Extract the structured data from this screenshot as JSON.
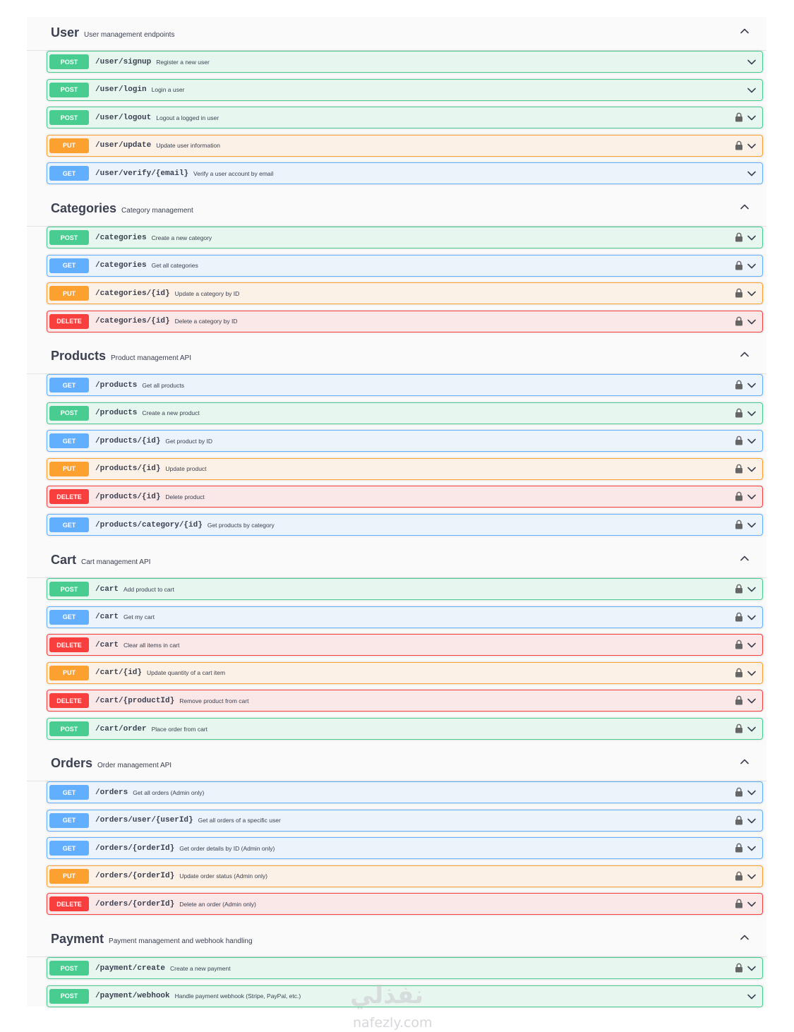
{
  "sections": [
    {
      "name": "User",
      "description": "User management endpoints",
      "operations": [
        {
          "method": "POST",
          "path": "/user/signup",
          "summary": "Register a new user",
          "locked": false
        },
        {
          "method": "POST",
          "path": "/user/login",
          "summary": "Login a user",
          "locked": false
        },
        {
          "method": "POST",
          "path": "/user/logout",
          "summary": "Logout a logged in user",
          "locked": true
        },
        {
          "method": "PUT",
          "path": "/user/update",
          "summary": "Update user information",
          "locked": true
        },
        {
          "method": "GET",
          "path": "/user/verify/{email}",
          "summary": "Verify a user account by email",
          "locked": false
        }
      ]
    },
    {
      "name": "Categories",
      "description": "Category management",
      "operations": [
        {
          "method": "POST",
          "path": "/categories",
          "summary": "Create a new category",
          "locked": true
        },
        {
          "method": "GET",
          "path": "/categories",
          "summary": "Get all categories",
          "locked": true
        },
        {
          "method": "PUT",
          "path": "/categories/{id}",
          "summary": "Update a category by ID",
          "locked": true
        },
        {
          "method": "DELETE",
          "path": "/categories/{id}",
          "summary": "Delete a category by ID",
          "locked": true
        }
      ]
    },
    {
      "name": "Products",
      "description": "Product management API",
      "operations": [
        {
          "method": "GET",
          "path": "/products",
          "summary": "Get all products",
          "locked": true
        },
        {
          "method": "POST",
          "path": "/products",
          "summary": "Create a new product",
          "locked": true
        },
        {
          "method": "GET",
          "path": "/products/{id}",
          "summary": "Get product by ID",
          "locked": true
        },
        {
          "method": "PUT",
          "path": "/products/{id}",
          "summary": "Update product",
          "locked": true
        },
        {
          "method": "DELETE",
          "path": "/products/{id}",
          "summary": "Delete product",
          "locked": true
        },
        {
          "method": "GET",
          "path": "/products/category/{id}",
          "summary": "Get products by category",
          "locked": true
        }
      ]
    },
    {
      "name": "Cart",
      "description": "Cart management API",
      "operations": [
        {
          "method": "POST",
          "path": "/cart",
          "summary": "Add product to cart",
          "locked": true
        },
        {
          "method": "GET",
          "path": "/cart",
          "summary": "Get my cart",
          "locked": true
        },
        {
          "method": "DELETE",
          "path": "/cart",
          "summary": "Clear all items in cart",
          "locked": true
        },
        {
          "method": "PUT",
          "path": "/cart/{id}",
          "summary": "Update quantity of a cart item",
          "locked": true
        },
        {
          "method": "DELETE",
          "path": "/cart/{productId}",
          "summary": "Remove product from cart",
          "locked": true
        },
        {
          "method": "POST",
          "path": "/cart/order",
          "summary": "Place order from cart",
          "locked": true
        }
      ]
    },
    {
      "name": "Orders",
      "description": "Order management API",
      "operations": [
        {
          "method": "GET",
          "path": "/orders",
          "summary": "Get all orders (Admin only)",
          "locked": true
        },
        {
          "method": "GET",
          "path": "/orders/user/{userId}",
          "summary": "Get all orders of a specific user",
          "locked": true
        },
        {
          "method": "GET",
          "path": "/orders/{orderId}",
          "summary": "Get order details by ID (Admin only)",
          "locked": true
        },
        {
          "method": "PUT",
          "path": "/orders/{orderId}",
          "summary": "Update order status (Admin only)",
          "locked": true
        },
        {
          "method": "DELETE",
          "path": "/orders/{orderId}",
          "summary": "Delete an order (Admin only)",
          "locked": true
        }
      ]
    },
    {
      "name": "Payment",
      "description": "Payment management and webhook handling",
      "operations": [
        {
          "method": "POST",
          "path": "/payment/create",
          "summary": "Create a new payment",
          "locked": true
        },
        {
          "method": "POST",
          "path": "/payment/webhook",
          "summary": "Handle payment webhook (Stripe, PayPal, etc.)",
          "locked": false
        }
      ]
    }
  ],
  "colors": {
    "POST": "#49cc90",
    "GET": "#61affe",
    "PUT": "#fca130",
    "DELETE": "#f93e3e"
  },
  "icons": {
    "section_toggle": "chevron-up-icon",
    "operation_toggle": "chevron-down-icon",
    "auth": "lock-icon"
  },
  "watermark": {
    "arabic": "نفذلي",
    "latin": "nafezly.com"
  }
}
